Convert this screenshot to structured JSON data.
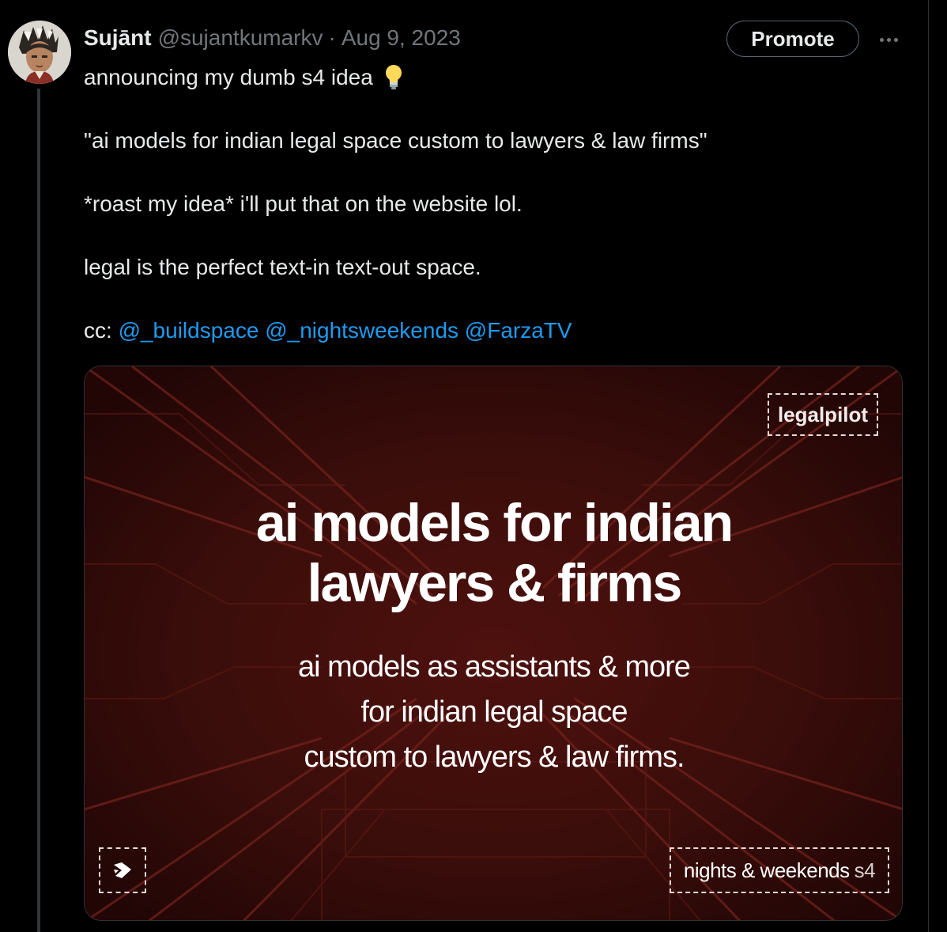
{
  "colors": {
    "background": "#000000",
    "text_primary": "#e7e9ea",
    "text_secondary": "#71767b",
    "mention": "#1d9bf0",
    "media_red": "#3a0c0a"
  },
  "tweet": {
    "author_name": "Sujānt",
    "author_handle": "@sujantkumarkv",
    "separator": "·",
    "date": "Aug 9, 2023",
    "promote_label": "Promote",
    "more_icon": "more-horizontal-icon",
    "lines": {
      "line1": "announcing my dumb s4 idea",
      "line1_emoji": "lightbulb-icon",
      "line2": "\"ai models for indian legal space custom to lawyers & law firms\"",
      "line3": "*roast my idea* i'll put that on the website lol.",
      "line4": "legal is the perfect text-in text-out space.",
      "cc_prefix": "cc:"
    },
    "mentions": [
      "@_buildspace",
      "@_nightsweekends",
      "@FarzaTV"
    ]
  },
  "media": {
    "brand": "legalpilot",
    "headline_line1": "ai models for indian",
    "headline_line2": "lawyers & firms",
    "sub_line1": "ai models as assistants & more",
    "sub_line2": "for indian legal space",
    "sub_line3": "custom to lawyers & law firms.",
    "footer_label": "nights & weekends",
    "footer_season": "s4",
    "logo_icon": "buildspace-logo-icon"
  }
}
